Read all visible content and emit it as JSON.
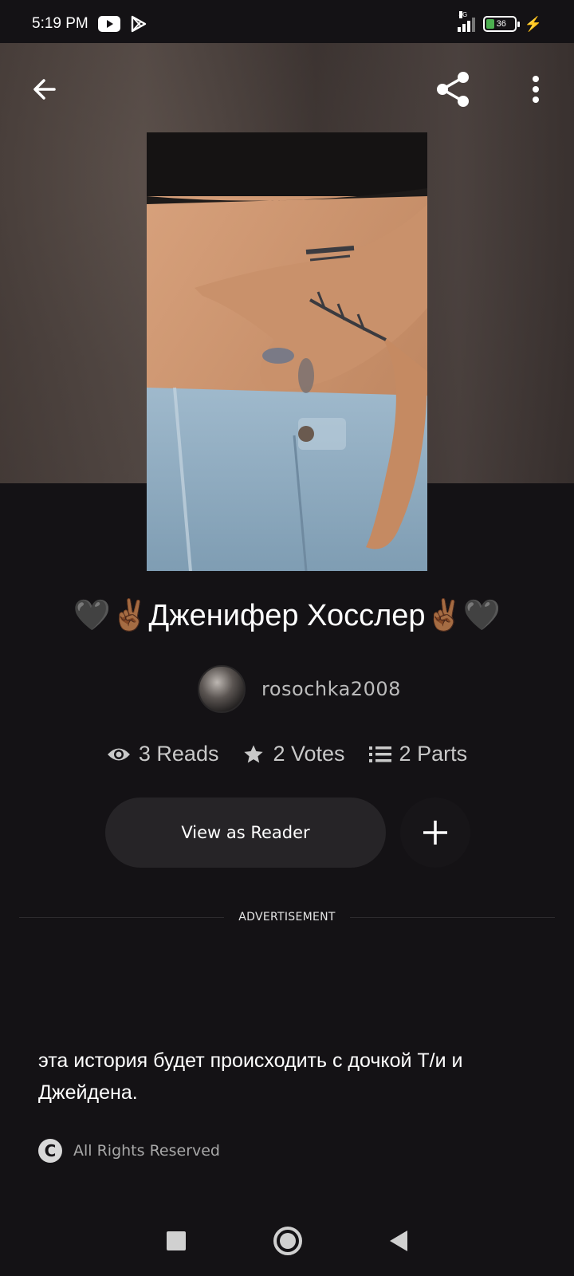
{
  "status_bar": {
    "time": "5:19 PM",
    "network": "4G",
    "battery": "36",
    "icons": [
      "youtube-icon",
      "play-store-icon",
      "signal-icon",
      "battery-icon",
      "charging-icon"
    ]
  },
  "header": {
    "back_icon": "arrow-left-icon",
    "share_icon": "share-icon",
    "more_icon": "more-vertical-icon"
  },
  "story": {
    "title": "🖤✌🏾Дженифер Хосслер✌🏾🖤",
    "author": "rosochka2008",
    "stats": {
      "reads": "3 Reads",
      "votes": "2 Votes",
      "parts": "2 Parts"
    },
    "reader_button_label": "View as Reader",
    "add_icon": "plus-icon",
    "advertisement_label": "ADVERTISEMENT",
    "description": "эта история будет происходить с дочкой Т/и и Джейдена.",
    "rights": "All Rights Reserved"
  },
  "nav_bar": {
    "icons": [
      "recents-square-icon",
      "home-circle-icon",
      "back-triangle-icon"
    ]
  },
  "colors": {
    "background": "#141215",
    "button_bg": "#262427",
    "text_secondary": "#bcbcbc"
  }
}
